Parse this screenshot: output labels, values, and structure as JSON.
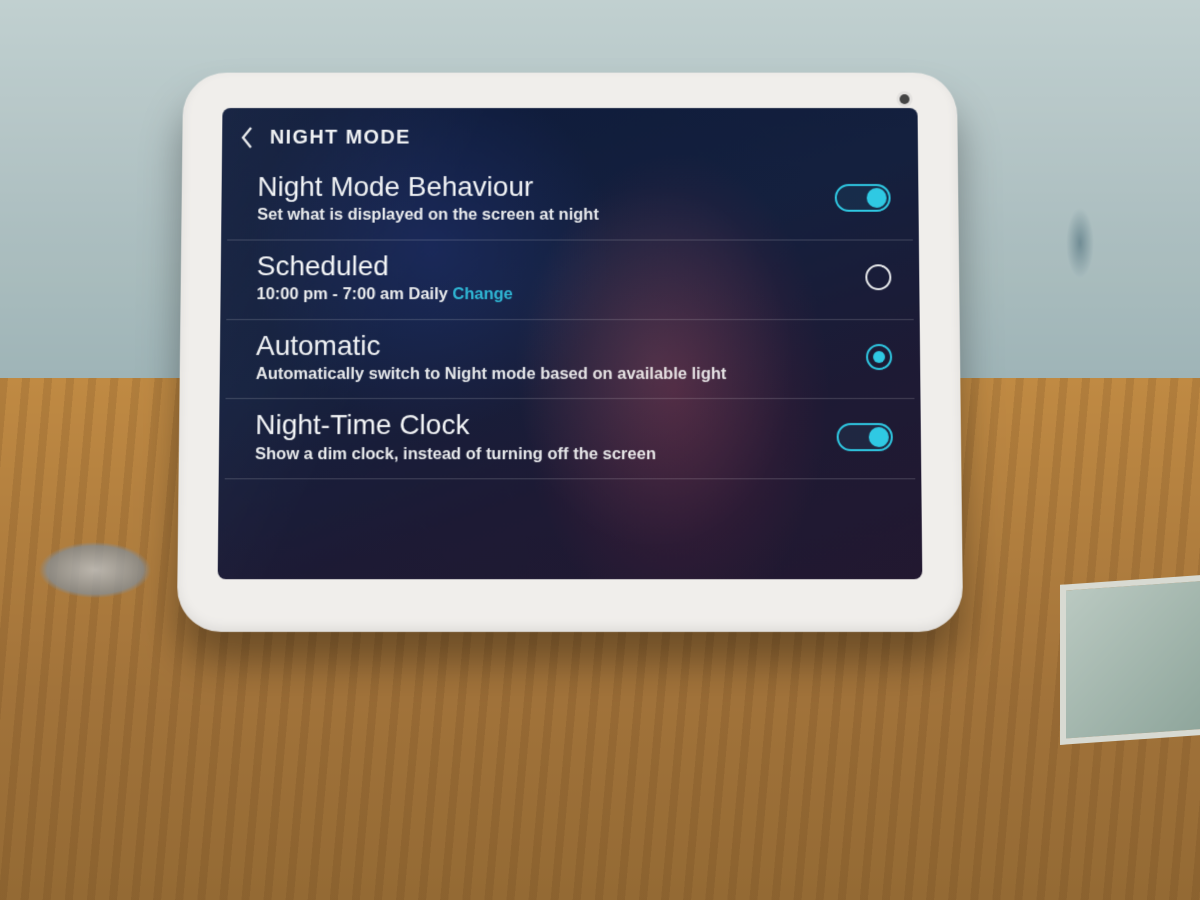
{
  "header": {
    "title": "NIGHT MODE"
  },
  "rows": {
    "behaviour": {
      "title": "Night Mode Behaviour",
      "subtitle": "Set what is displayed on the screen at night",
      "toggle_on": true
    },
    "scheduled": {
      "title": "Scheduled",
      "schedule_text": "10:00 pm - 7:00 am Daily",
      "change_label": "Change",
      "selected": false
    },
    "automatic": {
      "title": "Automatic",
      "subtitle": "Automatically switch to Night mode based on available light",
      "selected": true
    },
    "night_clock": {
      "title": "Night-Time Clock",
      "subtitle": "Show a dim clock, instead of turning off the screen",
      "toggle_on": true
    }
  },
  "colors": {
    "accent": "#2fc9e3",
    "link": "#2fb8d6"
  }
}
